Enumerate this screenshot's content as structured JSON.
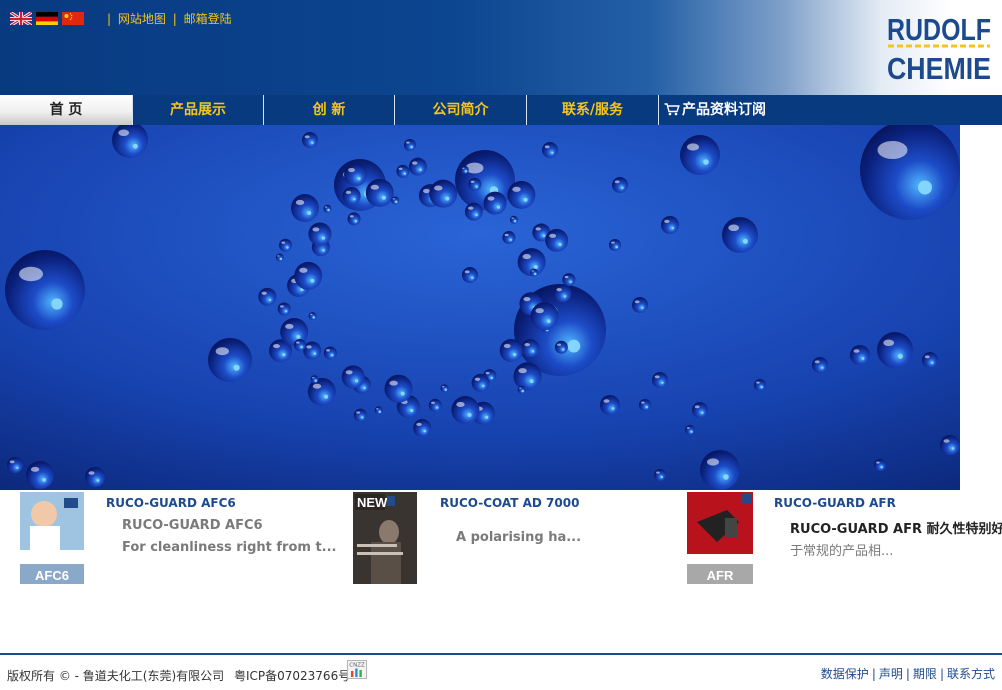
{
  "header": {
    "flags": [
      "english-flag-icon",
      "german-flag-icon",
      "chinese-flag-icon"
    ],
    "links": [
      "网站地图",
      "邮箱登陆"
    ],
    "logo": {
      "line1": "RUDOLF",
      "line2": "CHEMIE"
    }
  },
  "nav": {
    "items": [
      {
        "label": "首 页",
        "active": true
      },
      {
        "label": "产品展示"
      },
      {
        "label": "创 新"
      },
      {
        "label": "公司简介"
      },
      {
        "label": "联系/服务"
      },
      {
        "label": "产品资料订阅",
        "icon": "cart-icon"
      }
    ]
  },
  "products": [
    {
      "title": "RUCO-GUARD AFC6",
      "subtitle": "RUCO-GUARD AFC6",
      "desc": "For cleanliness right from t...",
      "image_label": "AFC6"
    },
    {
      "title": "RUCO-COAT AD 7000",
      "desc": "A polarising ha...",
      "image_label": "NEW"
    },
    {
      "title": "RUCO-GUARD AFR",
      "subtitle": "RUCO-GUARD AFR 耐久性特别好",
      "desc": "于常规的产品相...",
      "image_label": "AFR"
    }
  ],
  "footer": {
    "copyright": "版权所有 © - 鲁道夫化工(东莞)有限公司",
    "icp": "粤ICP备07023766号",
    "stat_label": "CNZZ",
    "links": [
      "数据保护",
      "声明",
      "期限",
      "联系方式"
    ]
  },
  "colors": {
    "brand_blue": "#083a80",
    "accent_yellow": "#f5c51b",
    "link_blue": "#1d4a8e"
  }
}
